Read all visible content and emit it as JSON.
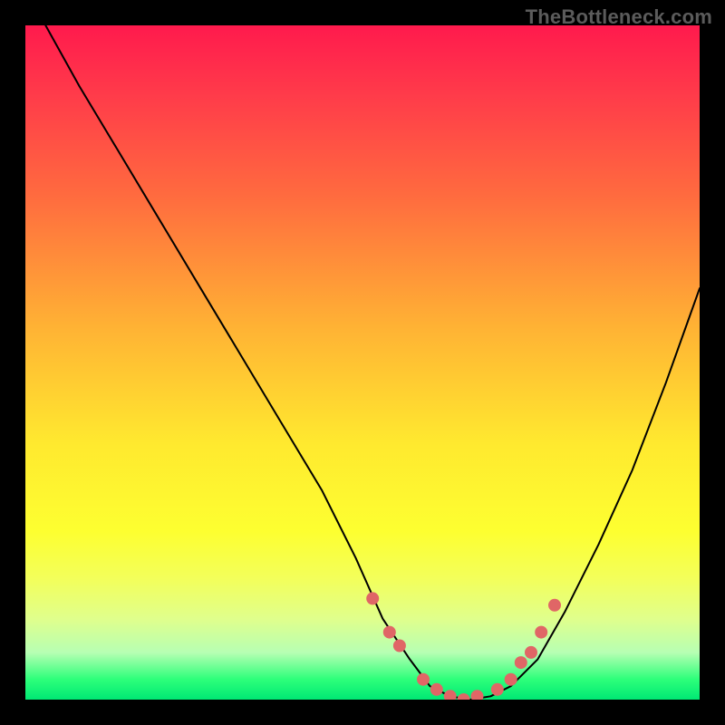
{
  "watermark": "TheBottleneck.com",
  "colors": {
    "gradient_top": "#ff1a4d",
    "gradient_mid": "#ffe92f",
    "gradient_bottom": "#00e874",
    "curve": "#000000",
    "dot": "#e06666",
    "frame": "#000000"
  },
  "chart_data": {
    "type": "line",
    "title": "",
    "xlabel": "",
    "ylabel": "",
    "xlim": [
      0,
      100
    ],
    "ylim": [
      0,
      100
    ],
    "series": [
      {
        "name": "bottleneck-curve",
        "x": [
          3,
          8,
          14,
          20,
          26,
          32,
          38,
          44,
          49,
          53,
          57,
          60,
          63,
          66,
          69,
          72,
          76,
          80,
          85,
          90,
          95,
          100
        ],
        "y": [
          100,
          91,
          81,
          71,
          61,
          51,
          41,
          31,
          21,
          12,
          6,
          2,
          0.5,
          0,
          0.5,
          2,
          6,
          13,
          23,
          34,
          47,
          61
        ]
      }
    ],
    "markers": {
      "name": "highlight-dots",
      "x": [
        51.5,
        54,
        55.5,
        59,
        61,
        63,
        65,
        67,
        70,
        72,
        73.5,
        75,
        76.5,
        78.5
      ],
      "y": [
        15,
        10,
        8,
        3,
        1.5,
        0.5,
        0,
        0.5,
        1.5,
        3,
        5.5,
        7,
        10,
        14
      ]
    }
  }
}
